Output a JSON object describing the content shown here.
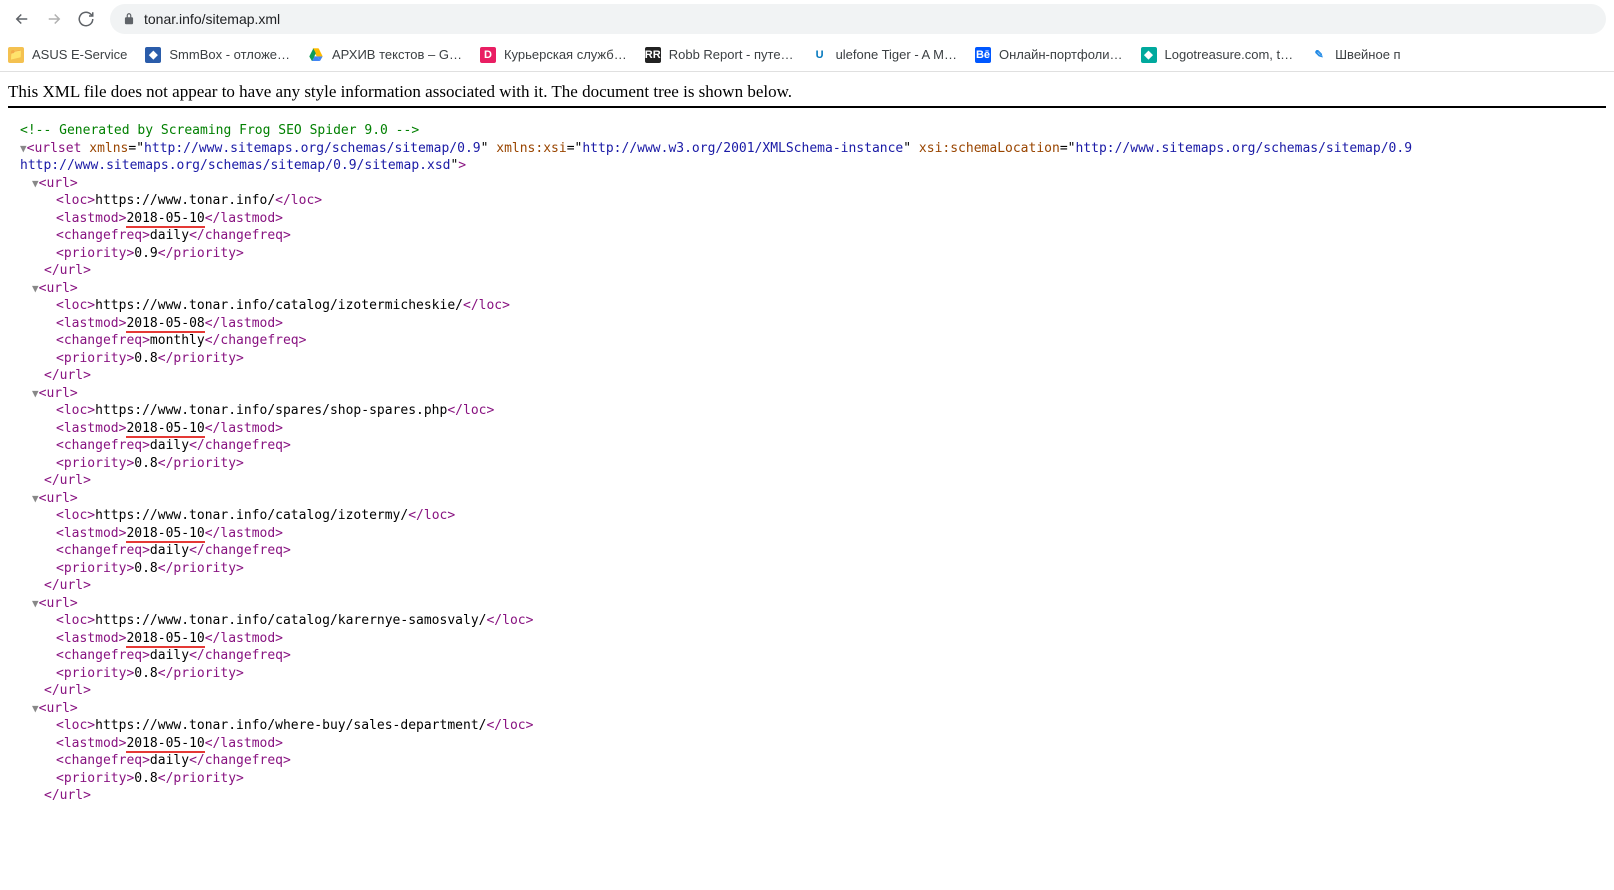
{
  "toolbar": {
    "url": "tonar.info/sitemap.xml"
  },
  "bookmarks": [
    {
      "label": "ASUS E-Service",
      "icon": "folder",
      "bg": "#f4c150",
      "fg": "#fff",
      "glyph": "📁"
    },
    {
      "label": "SmmBox - отложе…",
      "icon": "smm",
      "bg": "#2a5caa",
      "fg": "#fff",
      "glyph": "◆"
    },
    {
      "label": "АРХИВ текстов – G…",
      "icon": "gdrive",
      "bg": "",
      "fg": "",
      "glyph": "gdrive"
    },
    {
      "label": "Курьерская служб…",
      "icon": "d",
      "bg": "#e91e63",
      "fg": "#fff",
      "glyph": "D"
    },
    {
      "label": "Robb Report - путе…",
      "icon": "rr",
      "bg": "#222",
      "fg": "#fff",
      "glyph": "RR"
    },
    {
      "label": "ulefone Tiger - A M…",
      "icon": "ule",
      "bg": "#fff",
      "fg": "#0277bd",
      "glyph": "U"
    },
    {
      "label": "Онлайн-портфоли…",
      "icon": "be",
      "bg": "#0057ff",
      "fg": "#fff",
      "glyph": "Bē"
    },
    {
      "label": "Logotreasure.com, t…",
      "icon": "logo",
      "bg": "#00a99d",
      "fg": "#fff",
      "glyph": "◆"
    },
    {
      "label": "Швейное п",
      "icon": "sew",
      "bg": "#fff",
      "fg": "#1e88e5",
      "glyph": "✎"
    }
  ],
  "notice": "This XML file does not appear to have any style information associated with it. The document tree is shown below.",
  "xml": {
    "comment": "<!-- Generated by Screaming Frog SEO Spider 9.0 -->",
    "urlset_attrs": {
      "xmlns": "http://www.sitemaps.org/schemas/sitemap/0.9",
      "xmlns_xsi": "http://www.w3.org/2001/XMLSchema-instance",
      "xsi_schemaLocation": "http://www.sitemaps.org/schemas/sitemap/0.9 http://www.sitemaps.org/schemas/sitemap/0.9/sitemap.xsd"
    },
    "urls": [
      {
        "loc": "https://www.tonar.info/",
        "lastmod": "2018-05-10",
        "changefreq": "daily",
        "priority": "0.9",
        "hl": true
      },
      {
        "loc": "https://www.tonar.info/catalog/izotermicheskie/",
        "lastmod": "2018-05-08",
        "changefreq": "monthly",
        "priority": "0.8",
        "hl": true
      },
      {
        "loc": "https://www.tonar.info/spares/shop-spares.php",
        "lastmod": "2018-05-10",
        "changefreq": "daily",
        "priority": "0.8",
        "hl": true
      },
      {
        "loc": "https://www.tonar.info/catalog/izotermy/",
        "lastmod": "2018-05-10",
        "changefreq": "daily",
        "priority": "0.8",
        "hl": true
      },
      {
        "loc": "https://www.tonar.info/catalog/karernye-samosvaly/",
        "lastmod": "2018-05-10",
        "changefreq": "daily",
        "priority": "0.8",
        "hl": true
      },
      {
        "loc": "https://www.tonar.info/where-buy/sales-department/",
        "lastmod": "2018-05-10",
        "changefreq": "daily",
        "priority": "0.8",
        "hl": true
      }
    ]
  }
}
